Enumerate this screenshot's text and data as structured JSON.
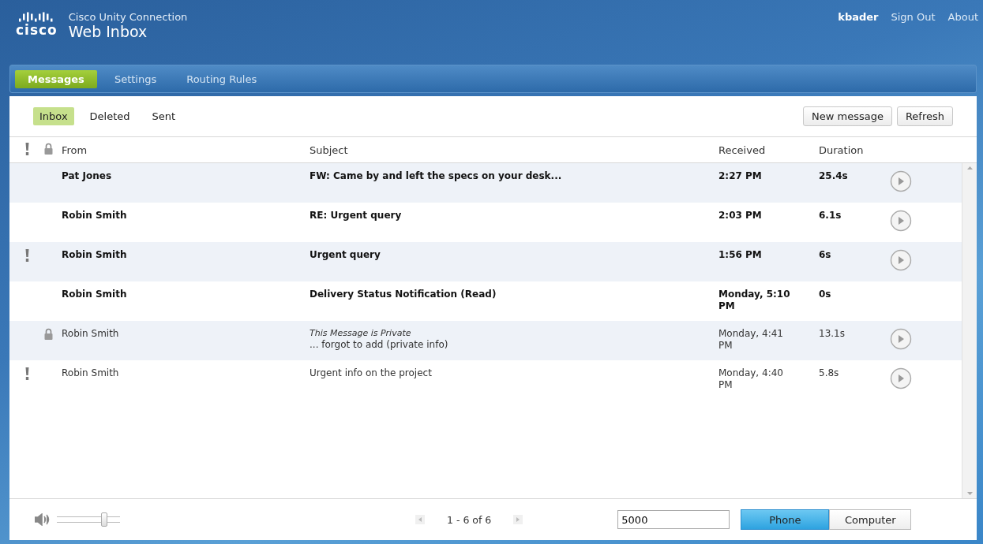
{
  "header": {
    "logo": "cisco",
    "product": "Cisco Unity Connection",
    "title": "Web Inbox",
    "user": "kbader",
    "links": [
      "Sign Out",
      "About"
    ]
  },
  "nav_tabs": [
    {
      "label": "Messages",
      "selected": true
    },
    {
      "label": "Settings",
      "selected": false
    },
    {
      "label": "Routing Rules",
      "selected": false
    }
  ],
  "folders": [
    {
      "label": "Inbox",
      "selected": true
    },
    {
      "label": "Deleted",
      "selected": false
    },
    {
      "label": "Sent",
      "selected": false
    }
  ],
  "actions": [
    "New message",
    "Refresh"
  ],
  "table": {
    "columns": [
      "From",
      "Subject",
      "Received",
      "Duration"
    ],
    "rows": [
      {
        "from": "Pat Jones",
        "subject": "FW: Came by and left the specs on your desk...",
        "received": "2:27 PM",
        "duration": "25.4s",
        "unread": true,
        "urgent": false,
        "private": false,
        "playable": true
      },
      {
        "from": "Robin Smith",
        "subject": "RE: Urgent query",
        "received": "2:03 PM",
        "duration": "6.1s",
        "unread": true,
        "urgent": false,
        "private": false,
        "playable": true
      },
      {
        "from": "Robin Smith",
        "subject": "Urgent query",
        "received": "1:56 PM",
        "duration": "6s",
        "unread": true,
        "urgent": true,
        "private": false,
        "playable": true
      },
      {
        "from": "Robin Smith",
        "subject": "Delivery Status Notification (Read)",
        "received": "Monday, 5:10 PM",
        "duration": "0s",
        "unread": true,
        "urgent": false,
        "private": false,
        "playable": false
      },
      {
        "from": "Robin Smith",
        "note": "This Message is Private",
        "subject": "... forgot to add (private info)",
        "received": "Monday, 4:41 PM",
        "duration": "13.1s",
        "unread": false,
        "urgent": false,
        "private": true,
        "playable": true
      },
      {
        "from": "Robin Smith",
        "subject": "Urgent info on the project",
        "received": "Monday, 4:40 PM",
        "duration": "5.8s",
        "unread": false,
        "urgent": true,
        "private": false,
        "playable": true
      }
    ]
  },
  "footer": {
    "volume": {
      "level": 0.8
    },
    "pager": "1 - 6 of 6",
    "extension": "5000",
    "outputs": [
      {
        "label": "Phone",
        "selected": true
      },
      {
        "label": "Computer",
        "selected": false
      }
    ]
  }
}
